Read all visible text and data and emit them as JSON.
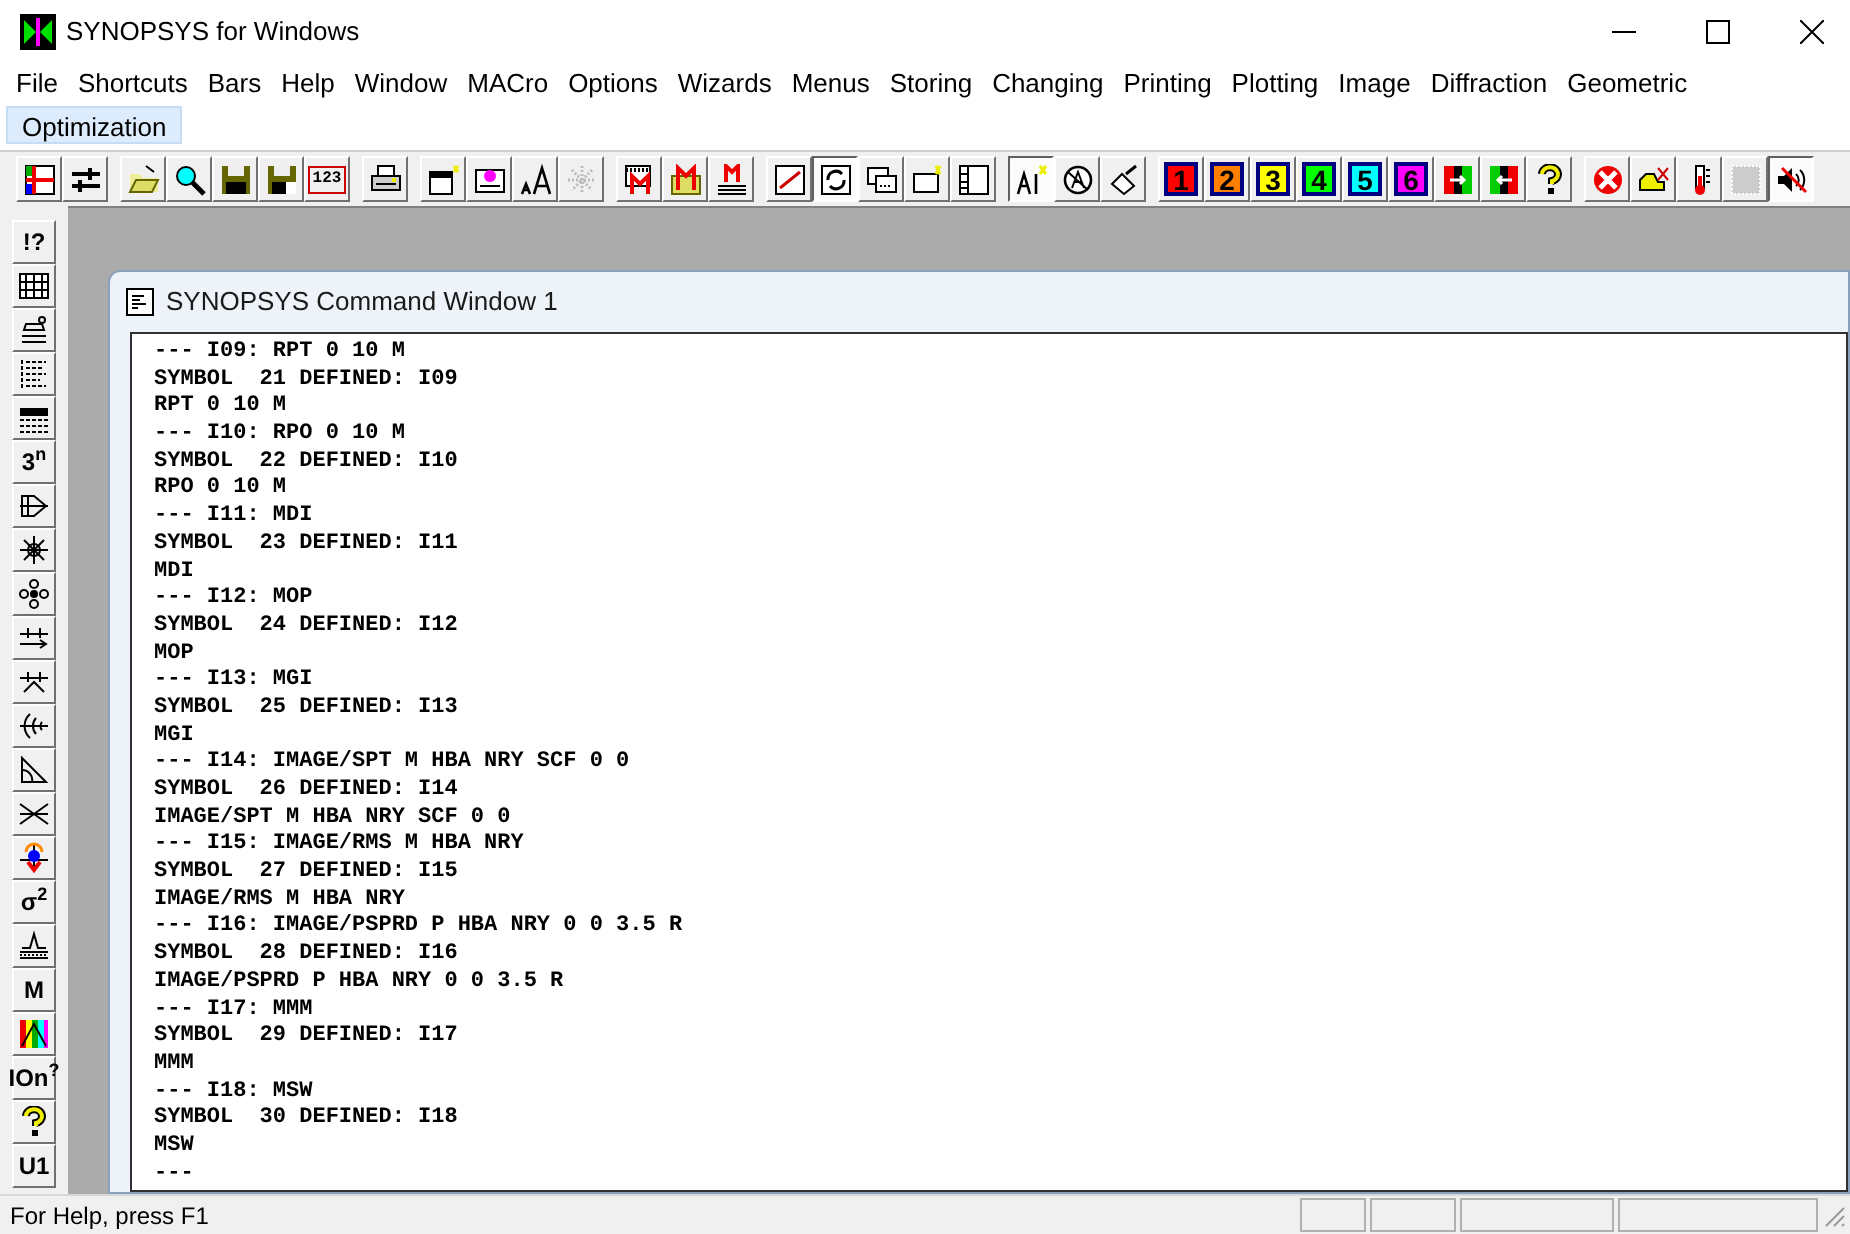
{
  "window": {
    "title": "SYNOPSYS for Windows"
  },
  "menu": [
    {
      "label": "File",
      "selected": false
    },
    {
      "label": "Shortcuts",
      "selected": false
    },
    {
      "label": "Bars",
      "selected": false
    },
    {
      "label": "Help",
      "selected": false
    },
    {
      "label": "Window",
      "selected": false
    },
    {
      "label": "MACro",
      "selected": false
    },
    {
      "label": "Options",
      "selected": false
    },
    {
      "label": "Wizards",
      "selected": false
    },
    {
      "label": "Menus",
      "selected": false
    },
    {
      "label": "Storing",
      "selected": false
    },
    {
      "label": "Changing",
      "selected": false
    },
    {
      "label": "Printing",
      "selected": false
    },
    {
      "label": "Plotting",
      "selected": false
    },
    {
      "label": "Image",
      "selected": false
    },
    {
      "label": "Diffraction",
      "selected": false
    },
    {
      "label": "Geometric",
      "selected": false
    },
    {
      "label": "Optimization",
      "selected": true
    }
  ],
  "toolbar": [
    [
      {
        "kind": "icon",
        "pressed": false
      },
      {
        "kind": "icon",
        "pressed": false
      }
    ],
    [
      {
        "kind": "icon",
        "pressed": false
      },
      {
        "kind": "icon",
        "pressed": false
      },
      {
        "kind": "icon",
        "pressed": false
      },
      {
        "kind": "icon",
        "pressed": false
      },
      {
        "kind": "text",
        "label": "123",
        "pressed": false
      }
    ],
    [
      {
        "kind": "icon",
        "pressed": false
      }
    ],
    [
      {
        "kind": "icon",
        "pressed": false
      },
      {
        "kind": "icon",
        "pressed": false
      },
      {
        "kind": "icon",
        "pressed": false
      },
      {
        "kind": "icon",
        "pressed": false
      }
    ],
    [
      {
        "kind": "icon",
        "pressed": false
      },
      {
        "kind": "icon",
        "pressed": false
      },
      {
        "kind": "icon",
        "pressed": false
      }
    ],
    [
      {
        "kind": "icon",
        "pressed": false
      },
      {
        "kind": "icon",
        "pressed": true
      },
      {
        "kind": "icon",
        "pressed": false
      },
      {
        "kind": "icon",
        "pressed": false
      },
      {
        "kind": "icon",
        "pressed": false
      }
    ],
    [
      {
        "kind": "icon",
        "pressed": true
      },
      {
        "kind": "icon",
        "pressed": false
      },
      {
        "kind": "icon",
        "pressed": false
      }
    ],
    [
      {
        "kind": "text",
        "label": "1",
        "color": "#ff0000",
        "pressed": false
      },
      {
        "kind": "text",
        "label": "2",
        "color": "#ff8000",
        "pressed": false
      },
      {
        "kind": "text",
        "label": "3",
        "color": "#ffff00",
        "pressed": false
      },
      {
        "kind": "text",
        "label": "4",
        "color": "#00ff00",
        "pressed": false
      },
      {
        "kind": "text",
        "label": "5",
        "color": "#00ffff",
        "pressed": false
      },
      {
        "kind": "text",
        "label": "6",
        "color": "#ff00ff",
        "pressed": false
      },
      {
        "kind": "icon",
        "pressed": false
      },
      {
        "kind": "icon",
        "pressed": false
      },
      {
        "kind": "icon",
        "pressed": false
      }
    ],
    [
      {
        "kind": "icon",
        "pressed": false
      },
      {
        "kind": "icon",
        "pressed": false
      },
      {
        "kind": "icon",
        "pressed": false
      },
      {
        "kind": "icon",
        "pressed": false
      },
      {
        "kind": "icon",
        "pressed": true
      }
    ]
  ],
  "side_toolbar": [
    {
      "kind": "text",
      "label": "!?"
    },
    {
      "kind": "icon"
    },
    {
      "kind": "icon"
    },
    {
      "kind": "icon"
    },
    {
      "kind": "icon"
    },
    {
      "kind": "text",
      "label": "3$^{n}$"
    },
    {
      "kind": "icon"
    },
    {
      "kind": "icon"
    },
    {
      "kind": "icon"
    },
    {
      "kind": "icon"
    },
    {
      "kind": "icon"
    },
    {
      "kind": "icon"
    },
    {
      "kind": "icon"
    },
    {
      "kind": "icon"
    },
    {
      "kind": "icon"
    },
    {
      "kind": "text",
      "label": "σ$^{2}$"
    },
    {
      "kind": "icon"
    },
    {
      "kind": "text",
      "label": "M"
    },
    {
      "kind": "icon"
    },
    {
      "kind": "text",
      "label": "IOn$^{?}$"
    },
    {
      "kind": "icon"
    },
    {
      "kind": "text",
      "label": "U1"
    }
  ],
  "command_window": {
    "title": "SYNOPSYS Command Window 1",
    "lines": [
      "--- I09: RPT 0 10 M",
      "SYMBOL  21 DEFINED: I09",
      "RPT 0 10 M",
      "--- I10: RPO 0 10 M",
      "SYMBOL  22 DEFINED: I10",
      "RPO 0 10 M",
      "--- I11: MDI",
      "SYMBOL  23 DEFINED: I11",
      "MDI",
      "--- I12: MOP",
      "SYMBOL  24 DEFINED: I12",
      "MOP",
      "--- I13: MGI",
      "SYMBOL  25 DEFINED: I13",
      "MGI",
      "--- I14: IMAGE/SPT M HBA NRY SCF 0 0",
      "SYMBOL  26 DEFINED: I14",
      "IMAGE/SPT M HBA NRY SCF 0 0",
      "--- I15: IMAGE/RMS M HBA NRY",
      "SYMBOL  27 DEFINED: I15",
      "IMAGE/RMS M HBA NRY",
      "--- I16: IMAGE/PSPRD P HBA NRY 0 0 3.5 R",
      "SYMBOL  28 DEFINED: I16",
      "IMAGE/PSPRD P HBA NRY 0 0 3.5 R",
      "--- I17: MMM",
      "SYMBOL  29 DEFINED: I17",
      "MMM",
      "--- I18: MSW",
      "SYMBOL  30 DEFINED: I18",
      "MSW",
      "---"
    ]
  },
  "status_bar": {
    "text": "For Help, press F1"
  }
}
